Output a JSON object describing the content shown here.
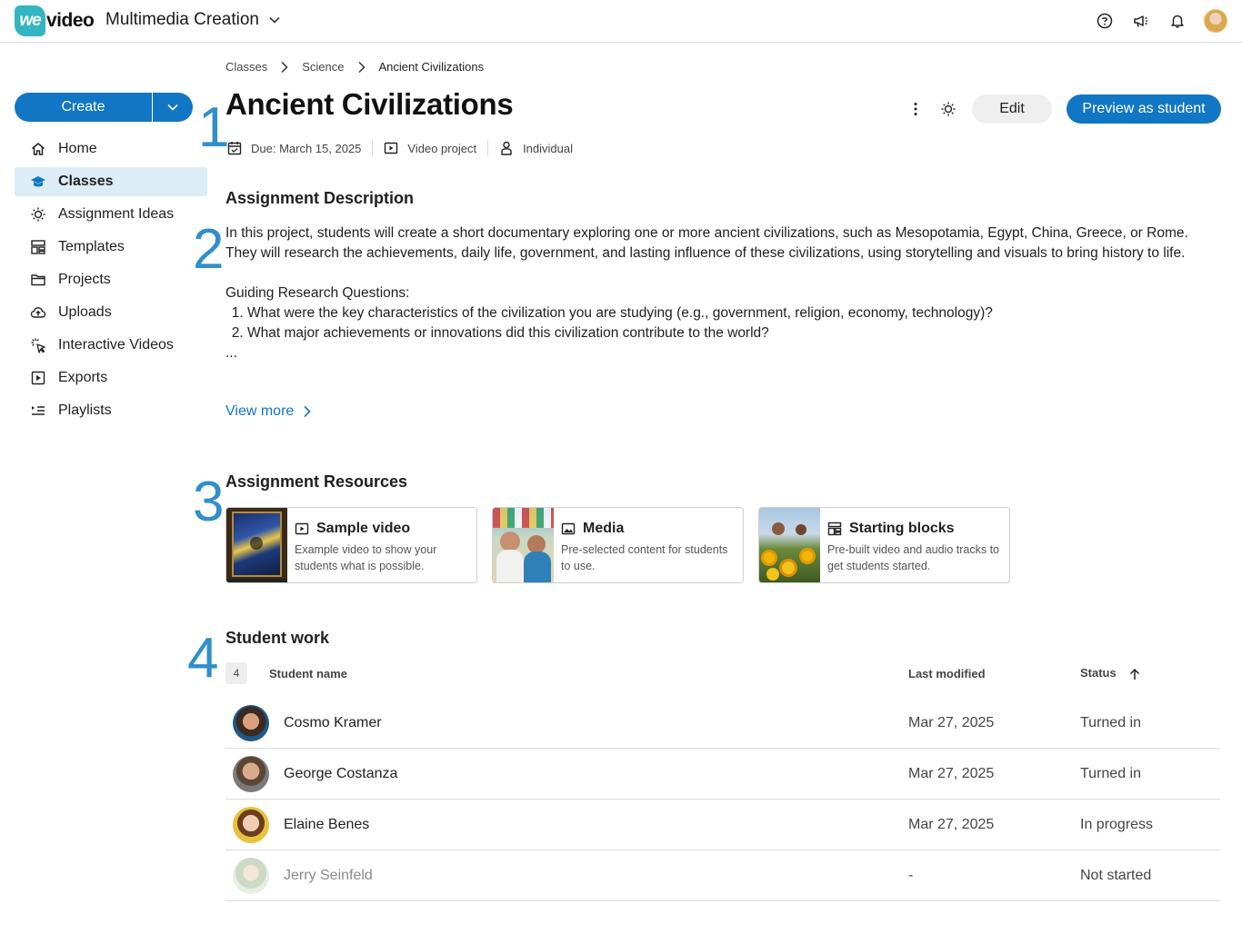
{
  "app": {
    "logo_badge": "we",
    "logo_text": "video",
    "workspace": "Multimedia Creation"
  },
  "topbar_icons": [
    "help-icon",
    "announcement-icon",
    "bell-icon",
    "user-avatar"
  ],
  "sidebar": {
    "create_label": "Create",
    "items": [
      {
        "label": "Home",
        "icon": "home-icon"
      },
      {
        "label": "Classes",
        "icon": "classes-icon",
        "active": true
      },
      {
        "label": "Assignment Ideas",
        "icon": "lightbulb-icon"
      },
      {
        "label": "Templates",
        "icon": "templates-icon"
      },
      {
        "label": "Projects",
        "icon": "folder-icon"
      },
      {
        "label": "Uploads",
        "icon": "upload-icon"
      },
      {
        "label": "Interactive Videos",
        "icon": "interactive-icon"
      },
      {
        "label": "Exports",
        "icon": "export-icon"
      },
      {
        "label": "Playlists",
        "icon": "playlist-icon"
      }
    ]
  },
  "step_numbers": [
    "1",
    "2",
    "3",
    "4"
  ],
  "breadcrumb": [
    "Classes",
    "Science",
    "Ancient Civilizations"
  ],
  "assignment": {
    "title": "Ancient Civilizations",
    "edit_label": "Edit",
    "preview_label": "Preview as student",
    "due": "Due: March 15, 2025",
    "type": "Video project",
    "mode": "Individual"
  },
  "description": {
    "heading": "Assignment Description",
    "paragraph": "In this project, students will create a short documentary exploring one or more ancient civilizations, such as Mesopotamia, Egypt, China, Greece, or Rome. They will research the achievements, daily life, government, and lasting influence of these civilizations, using storytelling and visuals to bring history to life.",
    "questions_heading": "Guiding Research Questions:",
    "questions": [
      "What were the key characteristics of the civilization you are studying (e.g., government, religion, economy, technology)?",
      "What major achievements or innovations did this civilization contribute to the world?"
    ],
    "ellipsis": "...",
    "view_more": "View more"
  },
  "resources": {
    "heading": "Assignment Resources",
    "cards": [
      {
        "title": "Sample video",
        "icon": "video-icon",
        "desc": "Example video to show your students what is possible."
      },
      {
        "title": "Media",
        "icon": "image-icon",
        "desc": "Pre-selected content for students to use."
      },
      {
        "title": "Starting blocks",
        "icon": "blocks-icon",
        "desc": "Pre-built video and audio tracks to get students started."
      }
    ]
  },
  "student_work": {
    "heading": "Student work",
    "count": "4",
    "col_name": "Student name",
    "col_modified": "Last modified",
    "col_status": "Status",
    "rows": [
      {
        "name": "Cosmo Kramer",
        "modified": "Mar 27, 2025",
        "status": "Turned in"
      },
      {
        "name": "George Costanza",
        "modified": "Mar 27, 2025",
        "status": "Turned in"
      },
      {
        "name": "Elaine Benes",
        "modified": "Mar 27, 2025",
        "status": "In progress"
      },
      {
        "name": "Jerry Seinfeld",
        "modified": "-",
        "status": "Not started"
      }
    ]
  },
  "colors": {
    "primary": "#1176c4",
    "active_nav_bg": "#dcedf8",
    "step_number": "#2f8fcc",
    "logo": "#33b5c2"
  }
}
